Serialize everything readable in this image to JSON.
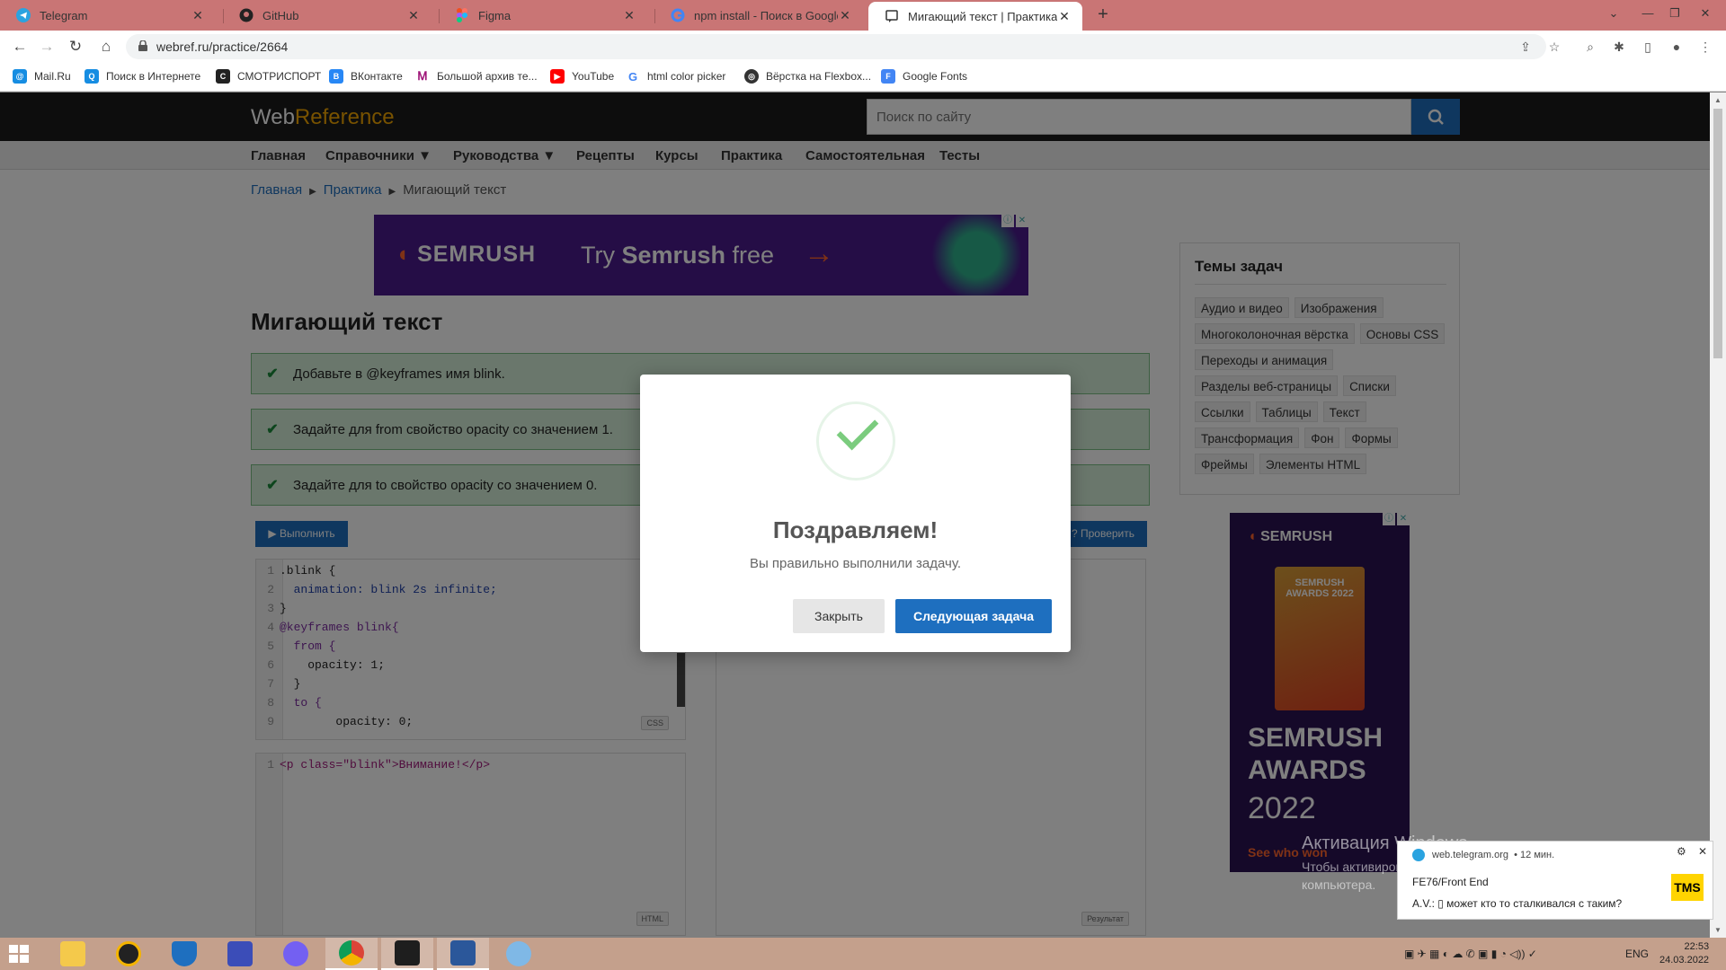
{
  "browser": {
    "tabs": [
      {
        "title": "Telegram",
        "icon": "telegram-icon"
      },
      {
        "title": "GitHub",
        "icon": "github-icon"
      },
      {
        "title": "Figma",
        "icon": "figma-icon"
      },
      {
        "title": "npm install - Поиск в Google",
        "icon": "google-icon"
      },
      {
        "title": "Мигающий текст | Практика | W",
        "icon": "page-icon",
        "active": true
      }
    ],
    "url": "webref.ru/practice/2664",
    "bookmarks": [
      {
        "label": "Mail.Ru",
        "color": "#168de2"
      },
      {
        "label": "Поиск в Интернете",
        "color": "#168de2"
      },
      {
        "label": "СМОТРИСПОРТ",
        "color": "#222222"
      },
      {
        "label": "ВКонтакте",
        "color": "#2787f5"
      },
      {
        "label": "Большой архив те...",
        "color": "#a0197a"
      },
      {
        "label": "YouTube",
        "color": "#ff0000"
      },
      {
        "label": "html color picker",
        "color": "#4285f4"
      },
      {
        "label": "Вёрстка на Flexbox...",
        "color": "#333333"
      },
      {
        "label": "Google Fonts",
        "color": "#4285f4"
      }
    ]
  },
  "site": {
    "logo_web": "Web",
    "logo_ref": "Reference",
    "search_placeholder": "Поиск по сайту",
    "nav": [
      "Главная",
      "Справочники ▼",
      "Руководства ▼",
      "Рецепты",
      "Курсы",
      "Практика",
      "Самостоятельная",
      "Тесты"
    ],
    "breadcrumbs": [
      "Главная",
      "Практика",
      "Мигающий текст"
    ]
  },
  "ad_banner": {
    "brand": "SEMRUSH",
    "text_prefix": "Try ",
    "text_bold": "Semrush",
    "text_suffix": " free",
    "arrow": "→"
  },
  "task": {
    "title": "Мигающий текст",
    "requirements": [
      "Добавьте в @keyframes имя blink.",
      "Задайте для from свойство opacity со значением 1.",
      "Задайте для to свойство opacity со значением 0."
    ],
    "run_label": "▶ Выполнить",
    "check_label": "? Проверить"
  },
  "editor_css": {
    "lang": "CSS",
    "lines": [
      ".blink {",
      "  animation: blink 2s infinite;",
      "}",
      "@keyframes blink{",
      "  from {",
      "    opacity: 1;",
      "  }",
      "  to {",
      "        opacity: 0;"
    ]
  },
  "editor_html": {
    "lang": "HTML",
    "lines": [
      "<p class=\"blink\">Внимание!</p>"
    ]
  },
  "result": {
    "label": "Результат"
  },
  "topics": {
    "title": "Темы задач",
    "items": [
      "Аудио и видео",
      "Изображения",
      "Многоколоночная вёрстка",
      "Основы CSS",
      "Переходы и анимация",
      "Разделы веб-страницы",
      "Списки",
      "Ссылки",
      "Таблицы",
      "Текст",
      "Трансформация",
      "Фон",
      "Формы",
      "Фреймы",
      "Элементы HTML"
    ]
  },
  "ad_side": {
    "brand": "SEMRUSH",
    "trophy_text": "SEMRUSH AWARDS 2022",
    "awards_line1": "SEMRUSH",
    "awards_line2": "AWARDS",
    "year": "2022",
    "cta": "See who won"
  },
  "modal": {
    "title": "Поздравляем!",
    "text": "Вы правильно выполнили задачу.",
    "close_label": "Закрыть",
    "next_label": "Следующая задача"
  },
  "windows_watermark": {
    "line1": "Активация Windows",
    "line2": "Чтобы активировать Windows, перейдите к параметрам компьютера."
  },
  "toast": {
    "source": "web.telegram.org",
    "time": "• 12 мин.",
    "line1": "FE76/Front End",
    "line2": "A.V.: ▯ может кто то сталкивался с таким?",
    "logo": "TMS"
  },
  "taskbar": {
    "lang": "ENG",
    "time": "22:53",
    "date": "24.03.2022"
  }
}
